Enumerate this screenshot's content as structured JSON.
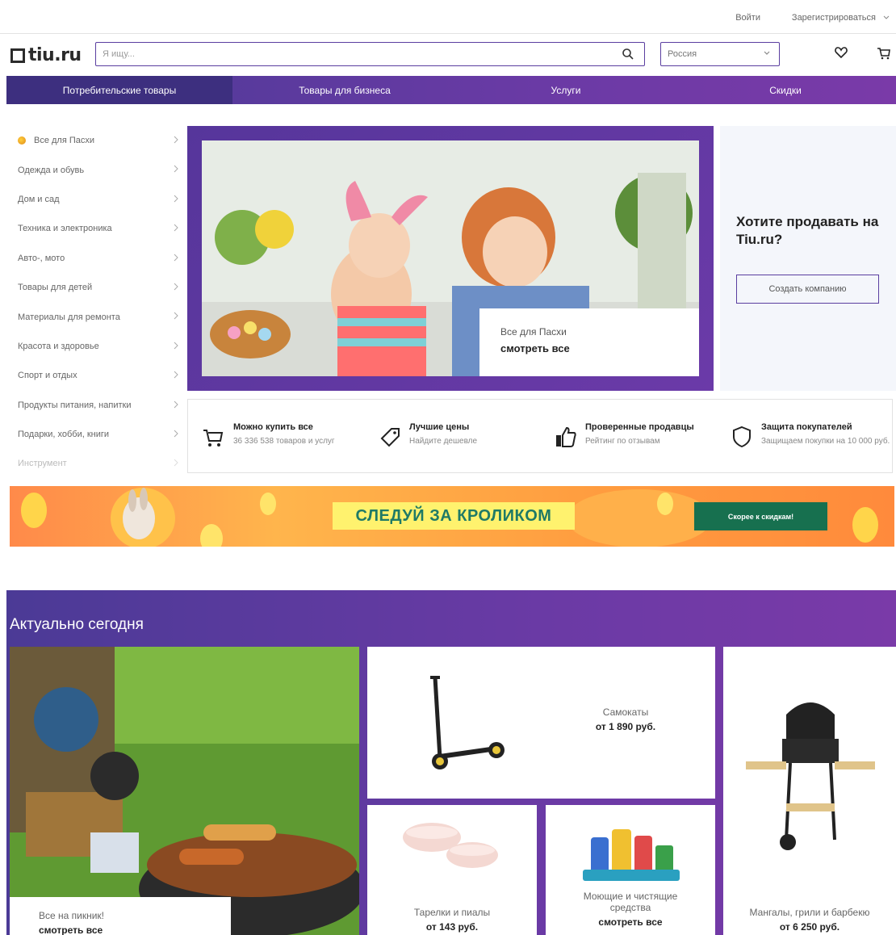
{
  "topbar": {
    "login": "Войти",
    "register": "Зарегистрироваться"
  },
  "header": {
    "logo": "tiu.ru",
    "search_placeholder": "Я ищу...",
    "region": "Россия"
  },
  "nav": [
    {
      "label": "Потребительские товары",
      "active": true
    },
    {
      "label": "Товары для бизнеса",
      "active": false
    },
    {
      "label": "Услуги",
      "active": false
    },
    {
      "label": "Скидки",
      "active": false
    }
  ],
  "sidebar": {
    "items": [
      "Все для Пасхи",
      "Одежда и обувь",
      "Дом и сад",
      "Техника и электроника",
      "Авто-, мото",
      "Товары для детей",
      "Материалы для ремонта",
      "Красота и здоровье",
      "Спорт и отдых",
      "Продукты питания, напитки",
      "Подарки, хобби, книги",
      "Инструмент"
    ]
  },
  "hero": {
    "caption_title": "Все для Пасхи",
    "caption_link": "смотреть все"
  },
  "sell": {
    "title": "Хотите продавать на Tiu.ru?",
    "button": "Создать компанию"
  },
  "features": [
    {
      "icon": "cart-icon",
      "title": "Можно купить все",
      "subtitle": "36 336 538 товаров и услуг"
    },
    {
      "icon": "price-tag-icon",
      "title": "Лучшие цены",
      "subtitle": "Найдите дешевле"
    },
    {
      "icon": "thumbs-up-icon",
      "title": "Проверенные продавцы",
      "subtitle": "Рейтинг по отзывам"
    },
    {
      "icon": "shield-icon",
      "title": "Защита покупателей",
      "subtitle": "Защищаем покупки на 10 000 руб."
    }
  ],
  "promo": {
    "label": "СЛЕДУЙ ЗА КРОЛИКОМ",
    "cta": "Скорее к скидкам!"
  },
  "today": {
    "heading": "Актуально сегодня",
    "picnic": {
      "title": "Все на пикник!",
      "link": "смотреть все"
    },
    "scooters": {
      "title": "Самокаты",
      "price": "от 1 890 руб."
    },
    "plates": {
      "title": "Тарелки и пиалы",
      "price": "от 143 руб."
    },
    "cleaning": {
      "title": "Моющие и чистящие средства",
      "link": "смотреть все"
    },
    "grills": {
      "title": "Мангалы, грили и барбекю",
      "price": "от 6 250 руб."
    }
  },
  "colors": {
    "brand_purple": "#5a3ea0",
    "promo_green": "#17704f",
    "promo_yellow": "#fff26e"
  }
}
